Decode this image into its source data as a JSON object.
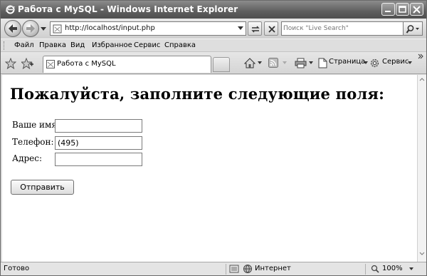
{
  "window": {
    "title": "Работа с MySQL - Windows Internet Explorer"
  },
  "address_bar": {
    "url": "http://localhost/input.php"
  },
  "search": {
    "placeholder": "Поиск \"Live Search\""
  },
  "menu": {
    "items": [
      {
        "label": "Файл"
      },
      {
        "label": "Правка"
      },
      {
        "label": "Вид"
      },
      {
        "label": "Избранное"
      },
      {
        "label": "Сервис"
      },
      {
        "label": "Справка"
      }
    ]
  },
  "tab": {
    "label": "Работа с MySQL"
  },
  "commands": {
    "page_label": "Страница",
    "tools_label": "Сервис"
  },
  "page": {
    "heading": "Пожалуйста, заполните следующие поля:",
    "fields": [
      {
        "label": "Ваше имя:",
        "value": ""
      },
      {
        "label": "Телефон:",
        "value": "(495)"
      },
      {
        "label": "Адрес:",
        "value": ""
      }
    ],
    "submit_label": "Отправить"
  },
  "status": {
    "text": "Готово",
    "zone": "Интернет",
    "zoom": "100%"
  },
  "icons": {
    "window": "ie-icon",
    "back": "back-arrow-icon",
    "forward": "forward-arrow-icon",
    "refresh": "refresh-icon",
    "stop": "stop-icon",
    "search": "magnifier-icon",
    "favorites": "star-icon",
    "add_favorites": "add-favorite-icon",
    "home": "home-icon",
    "feeds": "rss-icon",
    "print": "printer-icon",
    "tools": "gear-icon",
    "internet_zone": "globe-icon",
    "zoom": "zoom-icon"
  }
}
